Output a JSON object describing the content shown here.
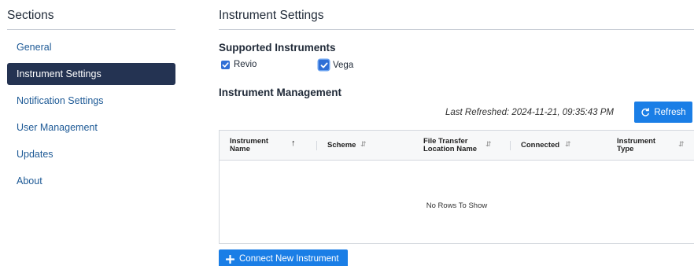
{
  "sidebar": {
    "title": "Sections",
    "items": [
      {
        "label": "General",
        "active": false
      },
      {
        "label": "Instrument Settings",
        "active": true
      },
      {
        "label": "Notification Settings",
        "active": false
      },
      {
        "label": "User Management",
        "active": false
      },
      {
        "label": "Updates",
        "active": false
      },
      {
        "label": "About",
        "active": false
      }
    ]
  },
  "main": {
    "title": "Instrument Settings",
    "supported": {
      "heading": "Supported Instruments",
      "options": [
        {
          "label": "Revio",
          "checked": true
        },
        {
          "label": "Vega",
          "checked": true
        }
      ]
    },
    "management": {
      "heading": "Instrument Management",
      "last_refreshed": "Last Refreshed: 2024-11-21, 09:35:43 PM",
      "refresh_label": "Refresh",
      "columns": [
        {
          "line1": "Instrument",
          "line2": "Name",
          "sort": "asc"
        },
        {
          "line1": "Scheme",
          "line2": "",
          "sort": "none"
        },
        {
          "line1": "File Transfer",
          "line2": "Location Name",
          "sort": "none"
        },
        {
          "line1": "Connected",
          "line2": "",
          "sort": "none"
        },
        {
          "line1": "Instrument",
          "line2": "Type",
          "sort": "none"
        }
      ],
      "empty_message": "No Rows To Show",
      "connect_label": "Connect New Instrument"
    }
  },
  "colors": {
    "accent": "#1a7ee6",
    "nav_active_bg": "#243352",
    "nav_link": "#1e5a96",
    "checkbox": "#2f6fd6"
  },
  "icons": {
    "refresh": "refresh-icon",
    "plus": "plus-icon",
    "sort_asc": "arrow-up-icon",
    "sort_none": "sort-icon",
    "check": "checkmark-icon"
  }
}
